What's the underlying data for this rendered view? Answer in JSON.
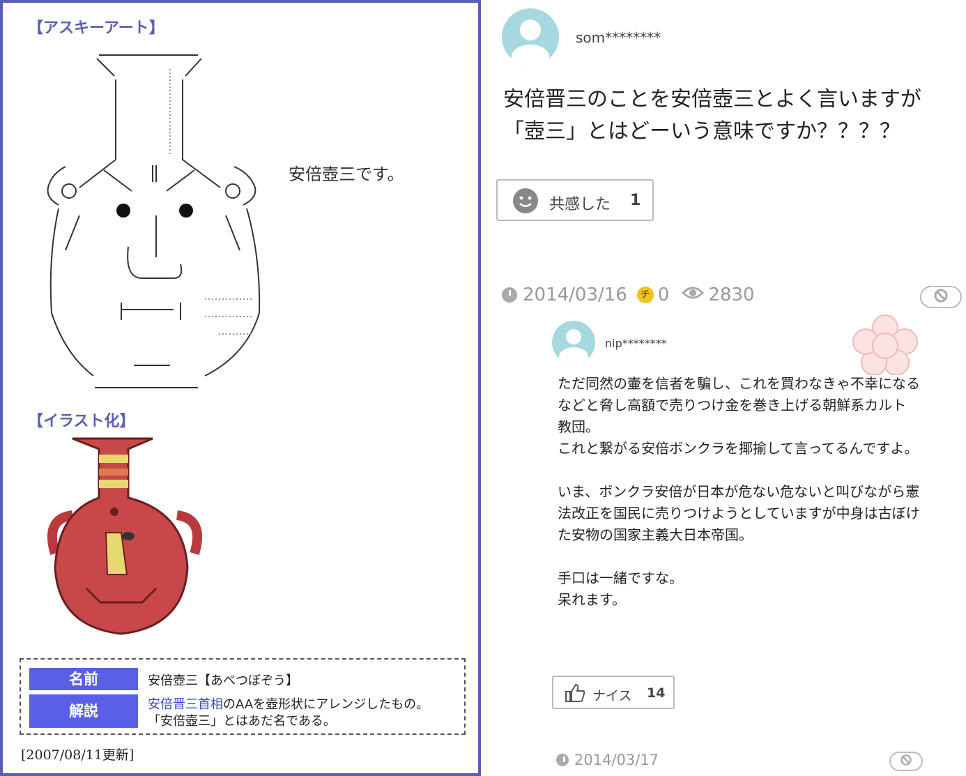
{
  "left": {
    "aa_section_title": "【アスキーアート】",
    "aa_caption": "安倍壺三です。",
    "illust_section_title": "【イラスト化】",
    "info": {
      "name_label": "名前",
      "name_value": "安倍壺三【あべつぼぞう】",
      "desc_label": "解説",
      "desc_link": "安倍晋三首相",
      "desc_rest": "のAAを壺形状にアレンジしたもの。",
      "desc_line2": "「安倍壺三」とはあだ名である。"
    },
    "updated": "[2007/08/11更新]"
  },
  "question": {
    "username": "som********",
    "text": "安倍晋三のことを安倍壺三とよく言いますが「壺三」とはどーいう意味ですか？？？？",
    "empathy_label": "共感した",
    "empathy_count": "1",
    "date": "2014/03/16",
    "coin_symbol": "チ",
    "coins": "0",
    "views": "2830"
  },
  "answer": {
    "username": "nip********",
    "text": "ただ同然の壷を信者を騙し、これを買わなきゃ不幸になるなどと脅し高額で売りつけ金を巻き上げる朝鮮系カルト教団。\nこれと繋がる安倍ボンクラを揶揄して言ってるんですよ。\n\nいま、ボンクラ安倍が日本が危ない危ないと叫びながら憲法改正を国民に売りつけようとしていますが中身は古ぼけた安物の国家主義大日本帝国。\n\n手口は一緒ですな。\n呆れます。",
    "nice_label": "ナイス",
    "nice_count": "14",
    "date": "2014/03/17"
  },
  "colors": {
    "frame": "#5a5fb5",
    "label_bg": "#5a5fe8",
    "avatar": "#a8d8df",
    "pot_red": "#c8484a",
    "pot_stripe": "#e8d870",
    "coin": "#f4c21c"
  }
}
